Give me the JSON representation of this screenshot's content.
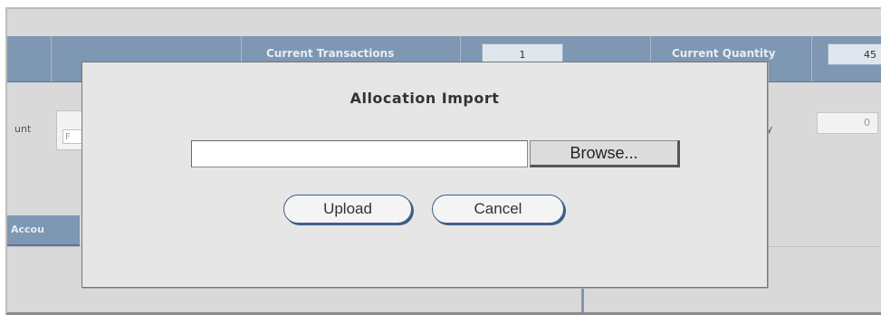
{
  "background": {
    "header": {
      "current_transactions_label": "Current Transactions",
      "current_transactions_value": "1",
      "current_quantity_label": "Current Quantity",
      "current_quantity_value": "45"
    },
    "row2": {
      "left_label": "unt",
      "small_field_text": "F",
      "right_label": "ntity",
      "right_value": "0"
    },
    "account_tab_label": "Accou"
  },
  "modal": {
    "title": "Allocation Import",
    "file_input_value": "",
    "browse_label": "Browse...",
    "upload_label": "Upload",
    "cancel_label": "Cancel"
  },
  "colors": {
    "header_blue": "#7e97b2",
    "button_border": "#3f5f86",
    "modal_bg": "#e6e6e6"
  }
}
